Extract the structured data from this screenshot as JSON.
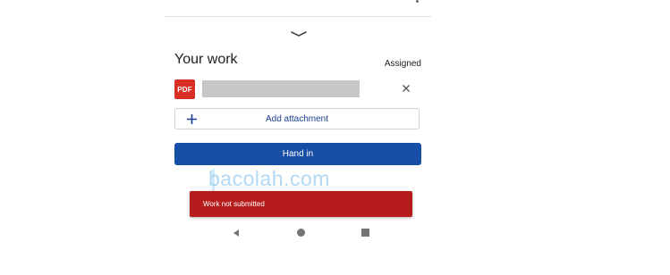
{
  "header": {
    "collapse_icon": "chevron-down-icon",
    "menu_icon": "more-vert-icon"
  },
  "your_work": {
    "title": "Your work",
    "status": "Assigned",
    "attachment": {
      "type_label": "PDF",
      "remove_icon": "close-icon"
    },
    "add_attachment_label": "Add attachment",
    "add_icon": "plus-icon",
    "hand_in_label": "Hand in"
  },
  "watermark": {
    "text": "bacolah.com"
  },
  "snackbar": {
    "message": "Work not submitted"
  },
  "nav_bar": {
    "back_icon": "back-triangle-icon",
    "home_icon": "home-circle-icon",
    "recents_icon": "recents-square-icon"
  },
  "colors": {
    "pdf_red": "#d93025",
    "hand_in_blue": "#174ea6",
    "add_attachment_text": "#1a3d8f",
    "snackbar_red": "#b71c1c"
  }
}
